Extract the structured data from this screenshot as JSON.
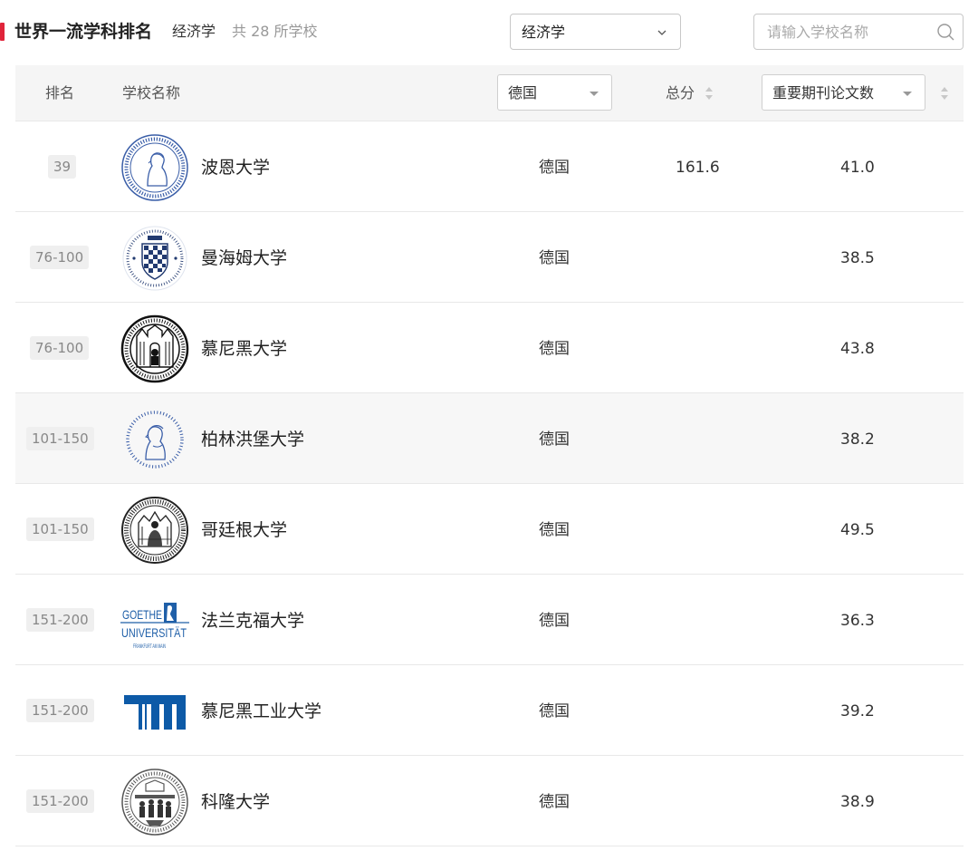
{
  "header": {
    "title": "世界一流学科排名",
    "subject": "经济学",
    "count": "共 28 所学校"
  },
  "filters": {
    "subject_value": "经济学",
    "search_placeholder": "请输入学校名称"
  },
  "table": {
    "columns": {
      "rank": "排名",
      "name": "学校名称",
      "country_filter": "德国",
      "total": "总分",
      "metric_filter": "重要期刊论文数"
    },
    "rows": [
      {
        "rank": "39",
        "name": "波恩大学",
        "country": "德国",
        "total": "161.6",
        "metric": "41.0",
        "logo": "bonn-seal-icon"
      },
      {
        "rank": "76-100",
        "name": "曼海姆大学",
        "country": "德国",
        "total": "",
        "metric": "38.5",
        "logo": "mannheim-seal-icon"
      },
      {
        "rank": "76-100",
        "name": "慕尼黑大学",
        "country": "德国",
        "total": "",
        "metric": "43.8",
        "logo": "lmu-seal-icon"
      },
      {
        "rank": "101-150",
        "name": "柏林洪堡大学",
        "country": "德国",
        "total": "",
        "metric": "38.2",
        "logo": "humboldt-seal-icon"
      },
      {
        "rank": "101-150",
        "name": "哥廷根大学",
        "country": "德国",
        "total": "",
        "metric": "49.5",
        "logo": "goettingen-seal-icon"
      },
      {
        "rank": "151-200",
        "name": "法兰克福大学",
        "country": "德国",
        "total": "",
        "metric": "36.3",
        "logo": "goethe-logo-icon"
      },
      {
        "rank": "151-200",
        "name": "慕尼黑工业大学",
        "country": "德国",
        "total": "",
        "metric": "39.2",
        "logo": "tum-logo-icon"
      },
      {
        "rank": "151-200",
        "name": "科隆大学",
        "country": "德国",
        "total": "",
        "metric": "38.9",
        "logo": "cologne-seal-icon"
      }
    ]
  },
  "colors": {
    "accent": "#e0243a",
    "seal_blue": "#3a5ea8",
    "tum_blue": "#0d5aa7",
    "goethe_blue": "#1f5fa8"
  }
}
